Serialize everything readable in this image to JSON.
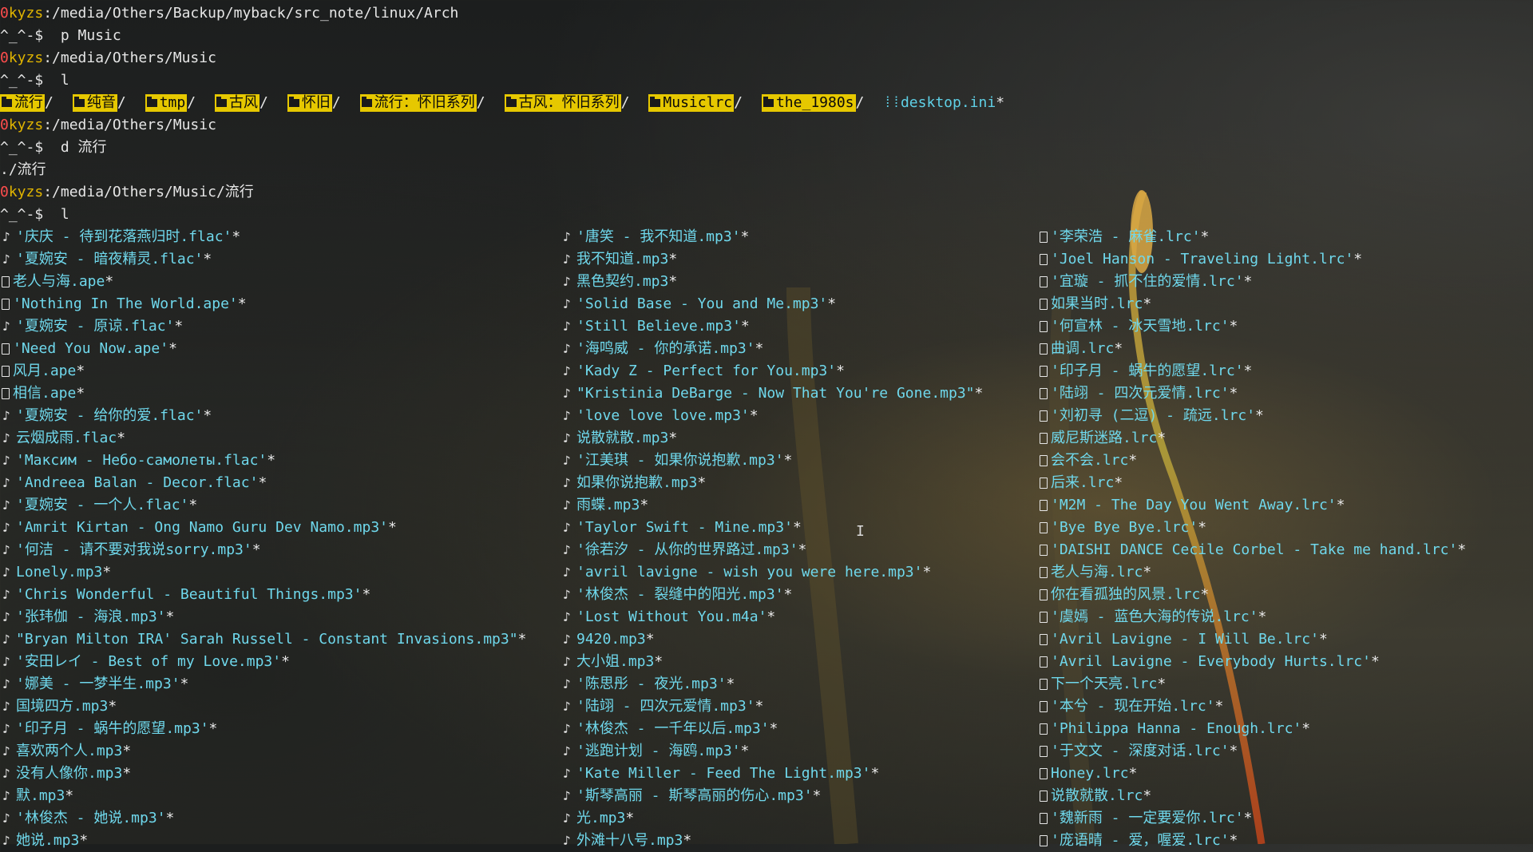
{
  "terminal": {
    "lines": [
      {
        "type": "status",
        "num": "0",
        "host": "kyzs",
        "path": ":/media/Others/Backup/myback/src_note/linux/Arch"
      },
      {
        "type": "prompt",
        "prompt": "^_^-$",
        "cmd": "  p Music"
      },
      {
        "type": "status",
        "num": "0",
        "host": "kyzs",
        "path": ":/media/Others/Music"
      },
      {
        "type": "prompt",
        "prompt": "^_^-$",
        "cmd": "  l"
      },
      {
        "type": "dirs"
      },
      {
        "type": "status",
        "num": "0",
        "host": "kyzs",
        "path": ":/media/Others/Music"
      },
      {
        "type": "prompt",
        "prompt": "^_^-$",
        "cmd": "  d 流行"
      },
      {
        "type": "plain",
        "text": "./流行"
      },
      {
        "type": "status",
        "num": "0",
        "host": "kyzs",
        "path": ":/media/Others/Music/流行"
      },
      {
        "type": "prompt",
        "prompt": "^_^-$",
        "cmd": "  l"
      }
    ],
    "dirs": [
      "流行",
      "纯音",
      "tmp",
      "古风",
      "怀旧",
      "流行：怀旧系列",
      "古风：怀旧系列",
      "Musiclrc",
      "the_1980s"
    ],
    "dir_suffix": "/",
    "ini_file": "desktop.ini",
    "ini_suffix": "*",
    "columns": [
      [
        {
          "icon": "music",
          "name": "'庆庆 - 待到花落燕归时.flac'"
        },
        {
          "icon": "music",
          "name": "'夏婉安 - 暗夜精灵.flac'"
        },
        {
          "icon": "file",
          "name": "老人与海.ape"
        },
        {
          "icon": "file",
          "name": "'Nothing In The World.ape'"
        },
        {
          "icon": "music",
          "name": "'夏婉安 - 原谅.flac'"
        },
        {
          "icon": "file",
          "name": "'Need You Now.ape'"
        },
        {
          "icon": "file",
          "name": "风月.ape"
        },
        {
          "icon": "file",
          "name": "相信.ape"
        },
        {
          "icon": "music",
          "name": "'夏婉安 - 给你的爱.flac'"
        },
        {
          "icon": "music",
          "name": "云烟成雨.flac"
        },
        {
          "icon": "music",
          "name": "'Максим - Небо-самолеты.flac'"
        },
        {
          "icon": "music",
          "name": "'Andreea Balan - Decor.flac'"
        },
        {
          "icon": "music",
          "name": "'夏婉安 - 一个人.flac'"
        },
        {
          "icon": "music",
          "name": "'Amrit Kirtan - Ong Namo Guru Dev Namo.mp3'"
        },
        {
          "icon": "music",
          "name": "'何洁 - 请不要对我说sorry.mp3'"
        },
        {
          "icon": "music",
          "name": "Lonely.mp3"
        },
        {
          "icon": "music",
          "name": "'Chris Wonderful - Beautiful Things.mp3'"
        },
        {
          "icon": "music",
          "name": "'张玮伽 - 海浪.mp3'"
        },
        {
          "icon": "music",
          "name": "\"Bryan Milton IRA' Sarah Russell - Constant Invasions.mp3\""
        },
        {
          "icon": "music",
          "name": "'安田レイ - Best of my Love.mp3'"
        },
        {
          "icon": "music",
          "name": "'娜美 - 一梦半生.mp3'"
        },
        {
          "icon": "music",
          "name": "国境四方.mp3"
        },
        {
          "icon": "music",
          "name": "'印子月 - 蜗牛的愿望.mp3'"
        },
        {
          "icon": "music",
          "name": "喜欢两个人.mp3"
        },
        {
          "icon": "music",
          "name": "没有人像你.mp3"
        },
        {
          "icon": "music",
          "name": "默.mp3"
        },
        {
          "icon": "music",
          "name": "'林俊杰 - 她说.mp3'"
        },
        {
          "icon": "music",
          "name": "她说.mp3"
        }
      ],
      [
        {
          "icon": "music",
          "name": "'唐笑 - 我不知道.mp3'"
        },
        {
          "icon": "music",
          "name": "我不知道.mp3"
        },
        {
          "icon": "music",
          "name": "黑色契约.mp3"
        },
        {
          "icon": "music",
          "name": "'Solid Base - You and Me.mp3'"
        },
        {
          "icon": "music",
          "name": "'Still Believe.mp3'"
        },
        {
          "icon": "music",
          "name": "'海鸣威 - 你的承诺.mp3'"
        },
        {
          "icon": "music",
          "name": "'Kady Z - Perfect for You.mp3'"
        },
        {
          "icon": "music",
          "name": "\"Kristinia DeBarge - Now That You're Gone.mp3\""
        },
        {
          "icon": "music",
          "name": "'love love love.mp3'"
        },
        {
          "icon": "music",
          "name": "说散就散.mp3"
        },
        {
          "icon": "music",
          "name": "'江美琪 - 如果你说抱歉.mp3'"
        },
        {
          "icon": "music",
          "name": "如果你说抱歉.mp3"
        },
        {
          "icon": "music",
          "name": "雨蝶.mp3"
        },
        {
          "icon": "music",
          "name": "'Taylor Swift - Mine.mp3'"
        },
        {
          "icon": "music",
          "name": "'徐若汐 - 从你的世界路过.mp3'"
        },
        {
          "icon": "music",
          "name": "'avril lavigne - wish you were here.mp3'"
        },
        {
          "icon": "music",
          "name": "'林俊杰 - 裂缝中的阳光.mp3'"
        },
        {
          "icon": "music",
          "name": "'Lost Without You.m4a'"
        },
        {
          "icon": "music",
          "name": "9420.mp3"
        },
        {
          "icon": "music",
          "name": "大小姐.mp3"
        },
        {
          "icon": "music",
          "name": "'陈思彤 - 夜光.mp3'"
        },
        {
          "icon": "music",
          "name": "'陆翊 - 四次元爱情.mp3'"
        },
        {
          "icon": "music",
          "name": "'林俊杰 - 一千年以后.mp3'"
        },
        {
          "icon": "music",
          "name": "'逃跑计划 - 海鸥.mp3'"
        },
        {
          "icon": "music",
          "name": "'Kate Miller - Feed The Light.mp3'"
        },
        {
          "icon": "music",
          "name": "'斯琴高丽 - 斯琴高丽的伤心.mp3'"
        },
        {
          "icon": "music",
          "name": "光.mp3"
        },
        {
          "icon": "music",
          "name": "外滩十八号.mp3"
        }
      ],
      [
        {
          "icon": "file",
          "name": "'李荣浩 - 麻雀.lrc'"
        },
        {
          "icon": "file",
          "name": "'Joel Hanson - Traveling Light.lrc'"
        },
        {
          "icon": "file",
          "name": "'宜璇 - 抓不住的爱情.lrc'"
        },
        {
          "icon": "file",
          "name": "如果当时.lrc"
        },
        {
          "icon": "file",
          "name": "'何宣林 - 冰天雪地.lrc'"
        },
        {
          "icon": "file",
          "name": "曲调.lrc"
        },
        {
          "icon": "file",
          "name": "'印子月 - 蜗牛的愿望.lrc'"
        },
        {
          "icon": "file",
          "name": "'陆翊 - 四次元爱情.lrc'"
        },
        {
          "icon": "file",
          "name": "'刘初寻 (二逗) - 疏远.lrc'"
        },
        {
          "icon": "file",
          "name": "威尼斯迷路.lrc"
        },
        {
          "icon": "file",
          "name": "会不会.lrc"
        },
        {
          "icon": "file",
          "name": "后来.lrc"
        },
        {
          "icon": "file",
          "name": "'M2M - The Day You Went Away.lrc'"
        },
        {
          "icon": "file",
          "name": "'Bye Bye Bye.lrc'"
        },
        {
          "icon": "file",
          "name": "'DAISHI DANCE Cecile Corbel - Take me hand.lrc'"
        },
        {
          "icon": "file",
          "name": "老人与海.lrc"
        },
        {
          "icon": "file",
          "name": "你在看孤独的风景.lrc"
        },
        {
          "icon": "file",
          "name": "'虞嫣 - 蓝色大海的传说.lrc'"
        },
        {
          "icon": "file",
          "name": "'Avril Lavigne - I Will Be.lrc'"
        },
        {
          "icon": "file",
          "name": "'Avril Lavigne - Everybody Hurts.lrc'"
        },
        {
          "icon": "file",
          "name": "下一个天亮.lrc"
        },
        {
          "icon": "file",
          "name": "'本兮 - 现在开始.lrc'"
        },
        {
          "icon": "file",
          "name": "'Philippa Hanna - Enough.lrc'"
        },
        {
          "icon": "file",
          "name": "'于文文 - 深度对话.lrc'"
        },
        {
          "icon": "file",
          "name": "Honey.lrc"
        },
        {
          "icon": "file",
          "name": "说散就散.lrc"
        },
        {
          "icon": "file",
          "name": "'魏新雨 - 一定要爱你.lrc'"
        },
        {
          "icon": "file",
          "name": "'庞语晴 - 爱，喔爱.lrc'"
        }
      ]
    ],
    "exec_suffix": "*"
  },
  "colors": {
    "prompt_number": "#ff4d4d",
    "host": "#e0b400",
    "filename": "#6fd8ec",
    "dir_bg": "#e6c800"
  },
  "icons": {
    "music": "music-note-icon",
    "file": "file-icon",
    "folder": "folder-icon",
    "ini": "grid-icon"
  }
}
